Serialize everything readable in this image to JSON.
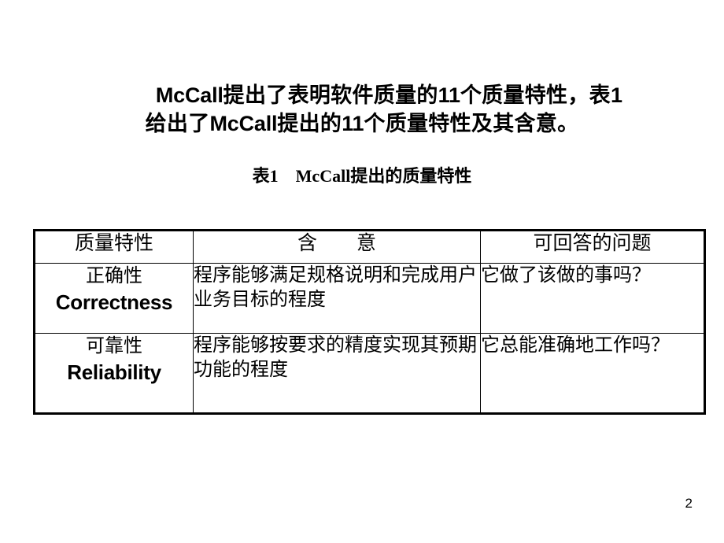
{
  "slide": {
    "page_number": "2",
    "title": {
      "line1_pre": "　　",
      "line1_brand": "McCall",
      "line1_mid": "提出了表明软件质量的",
      "line1_count": "11",
      "line1_post": "个质量特性，表",
      "line1_table_no": "1",
      "line2_pre": "给出了",
      "line2_brand": "McCall",
      "line2_mid": "提出的",
      "line2_count": "11",
      "line2_post": "个质量特性及其含意。"
    },
    "caption": {
      "prefix": "表",
      "number": "1",
      "spacer": "　",
      "brand": "McCall",
      "suffix": "提出的质量特性"
    }
  },
  "table": {
    "headers": {
      "characteristic": "质量特性",
      "meaning": "含　　意",
      "question": "可回答的问题"
    },
    "rows": [
      {
        "name_cn": "正确性",
        "name_en": "Correctness",
        "meaning": "程序能够满足规格说明和完成用户业务目标的程度",
        "question": "它做了该做的事吗？"
      },
      {
        "name_cn": "可靠性",
        "name_en": "Reliability",
        "meaning": "程序能够按要求的精度实现其预期功能的程度",
        "question": "它总能准确地工作吗？"
      }
    ]
  },
  "colors": {
    "background": "#ffffff",
    "text": "#000000",
    "table_border": "#000000"
  }
}
